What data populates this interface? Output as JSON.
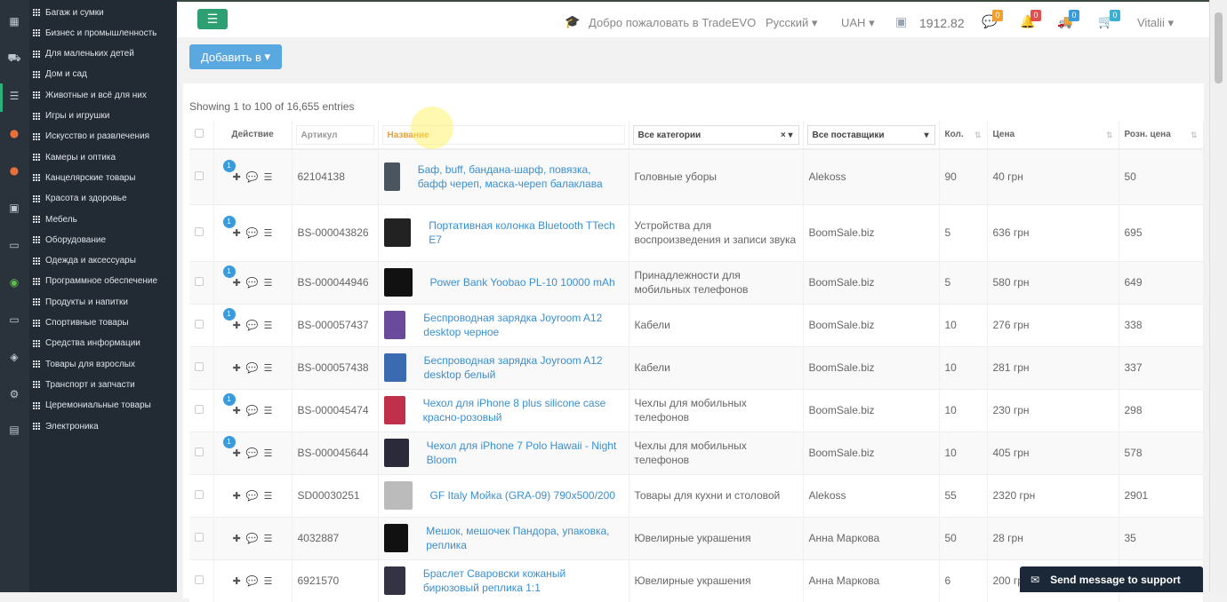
{
  "iconbar": {
    "icons": [
      "grid-icon",
      "truck-icon",
      "database-icon",
      "firefox-icon",
      "firefox-icon",
      "screen-icon",
      "window-icon",
      "app-icon",
      "laptop-icon",
      "puzzle-icon",
      "gears-icon",
      "briefcase-icon"
    ]
  },
  "categories": [
    "Багаж и сумки",
    "Бизнес и промышленность",
    "Для маленьких детей",
    "Дом и сад",
    "Животные и всё для них",
    "Игры и игрушки",
    "Искусство и развлечения",
    "Камеры и оптика",
    "Канцелярские товары",
    "Красота и здоровье",
    "Мебель",
    "Оборудование",
    "Одежда и аксессуары",
    "Программное обеспечение",
    "Продукты и напитки",
    "Спортивные товары",
    "Средства информации",
    "Товары для взрослых",
    "Транспорт и запчасти",
    "Церемониальные товары",
    "Электроника"
  ],
  "header": {
    "welcome": "Добро пожаловать в TradeEVO",
    "language": "Русский",
    "currency": "UAH",
    "balance": "1912.82",
    "badges": {
      "messages": "0",
      "notifications": "0",
      "shipping": "0",
      "cart": "0"
    },
    "user": "Vitalii",
    "colors": {
      "accent_green": "#2e9e73",
      "badge_orange": "#f0a030",
      "badge_red": "#e05050",
      "badge_blue": "#3a9bdc"
    }
  },
  "toolbar": {
    "add_button": "Добавить в"
  },
  "table": {
    "showing": "Showing 1 to 100 of 16,655 entries",
    "headers": {
      "action": "Действие",
      "sku": "Артикул",
      "name": "Название",
      "category": "Все категории",
      "supplier": "Все поставщики",
      "qty": "Кол.",
      "price": "Цена",
      "retail": "Розн. цена"
    },
    "rows": [
      {
        "badge": "1",
        "sku": "62104138",
        "name": "Баф, buff, бандана-шарф, повязка, бафф череп, маска-череп балаклава",
        "category": "Головные уборы",
        "supplier": "Alekoss",
        "qty": "90",
        "price": "40 грн",
        "retail": "50",
        "thumb": "#4a5560"
      },
      {
        "badge": "1",
        "sku": "BS-000043826",
        "name": "Портативная колонка Bluetooth TTech E7",
        "category": "Устройства для воспроизведения и записи звука",
        "supplier": "BoomSale.biz",
        "qty": "5",
        "price": "636 грн",
        "retail": "695",
        "thumb": "#222"
      },
      {
        "badge": "1",
        "sku": "BS-000044946",
        "name": "Power Bank Yoobao PL-10 10000 mAh",
        "category": "Принадлежности для мобильных телефонов",
        "supplier": "BoomSale.biz",
        "qty": "5",
        "price": "580 грн",
        "retail": "649",
        "thumb": "#111"
      },
      {
        "badge": "1",
        "sku": "BS-000057437",
        "name": "Беспроводная зарядка Joyroom A12 desktop черное",
        "category": "Кабели",
        "supplier": "BoomSale.biz",
        "qty": "10",
        "price": "276 грн",
        "retail": "338",
        "thumb": "#6a4a9a"
      },
      {
        "badge": "",
        "sku": "BS-000057438",
        "name": "Беспроводная зарядка Joyroom A12 desktop белый",
        "category": "Кабели",
        "supplier": "BoomSale.biz",
        "qty": "10",
        "price": "281 грн",
        "retail": "337",
        "thumb": "#3a6ab0"
      },
      {
        "badge": "1",
        "sku": "BS-000045474",
        "name": "Чехол для iPhone 8 plus silicone case красно-розовый",
        "category": "Чехлы для мобильных телефонов",
        "supplier": "BoomSale.biz",
        "qty": "10",
        "price": "230 грн",
        "retail": "298",
        "thumb": "#c0304a"
      },
      {
        "badge": "1",
        "sku": "BS-000045644",
        "name": "Чехол для iPhone 7 Polo Hawaii - Night Bloom",
        "category": "Чехлы для мобильных телефонов",
        "supplier": "BoomSale.biz",
        "qty": "10",
        "price": "405 грн",
        "retail": "578",
        "thumb": "#2a2a3a"
      },
      {
        "badge": "",
        "sku": "SD00030251",
        "name": "GF Italy Мойка (GRA-09) 790x500/200",
        "category": "Товары для кухни и столовой",
        "supplier": "Alekoss",
        "qty": "55",
        "price": "2320 грн",
        "retail": "2901",
        "thumb": "#bbb"
      },
      {
        "badge": "",
        "sku": "4032887",
        "name": "Мешок, мешочек Пандора, упаковка, реплика",
        "category": "Ювелирные украшения",
        "supplier": "Анна Маркова",
        "qty": "50",
        "price": "28 грн",
        "retail": "35",
        "thumb": "#111"
      },
      {
        "badge": "",
        "sku": "6921570",
        "name": "Браслет Сваровски кожаный бирюзовый реплика 1:1",
        "category": "Ювелирные украшения",
        "supplier": "Анна Маркова",
        "qty": "6",
        "price": "200 грн",
        "retail": "",
        "thumb": "#334"
      }
    ]
  },
  "support": {
    "label": "Send message to support"
  }
}
